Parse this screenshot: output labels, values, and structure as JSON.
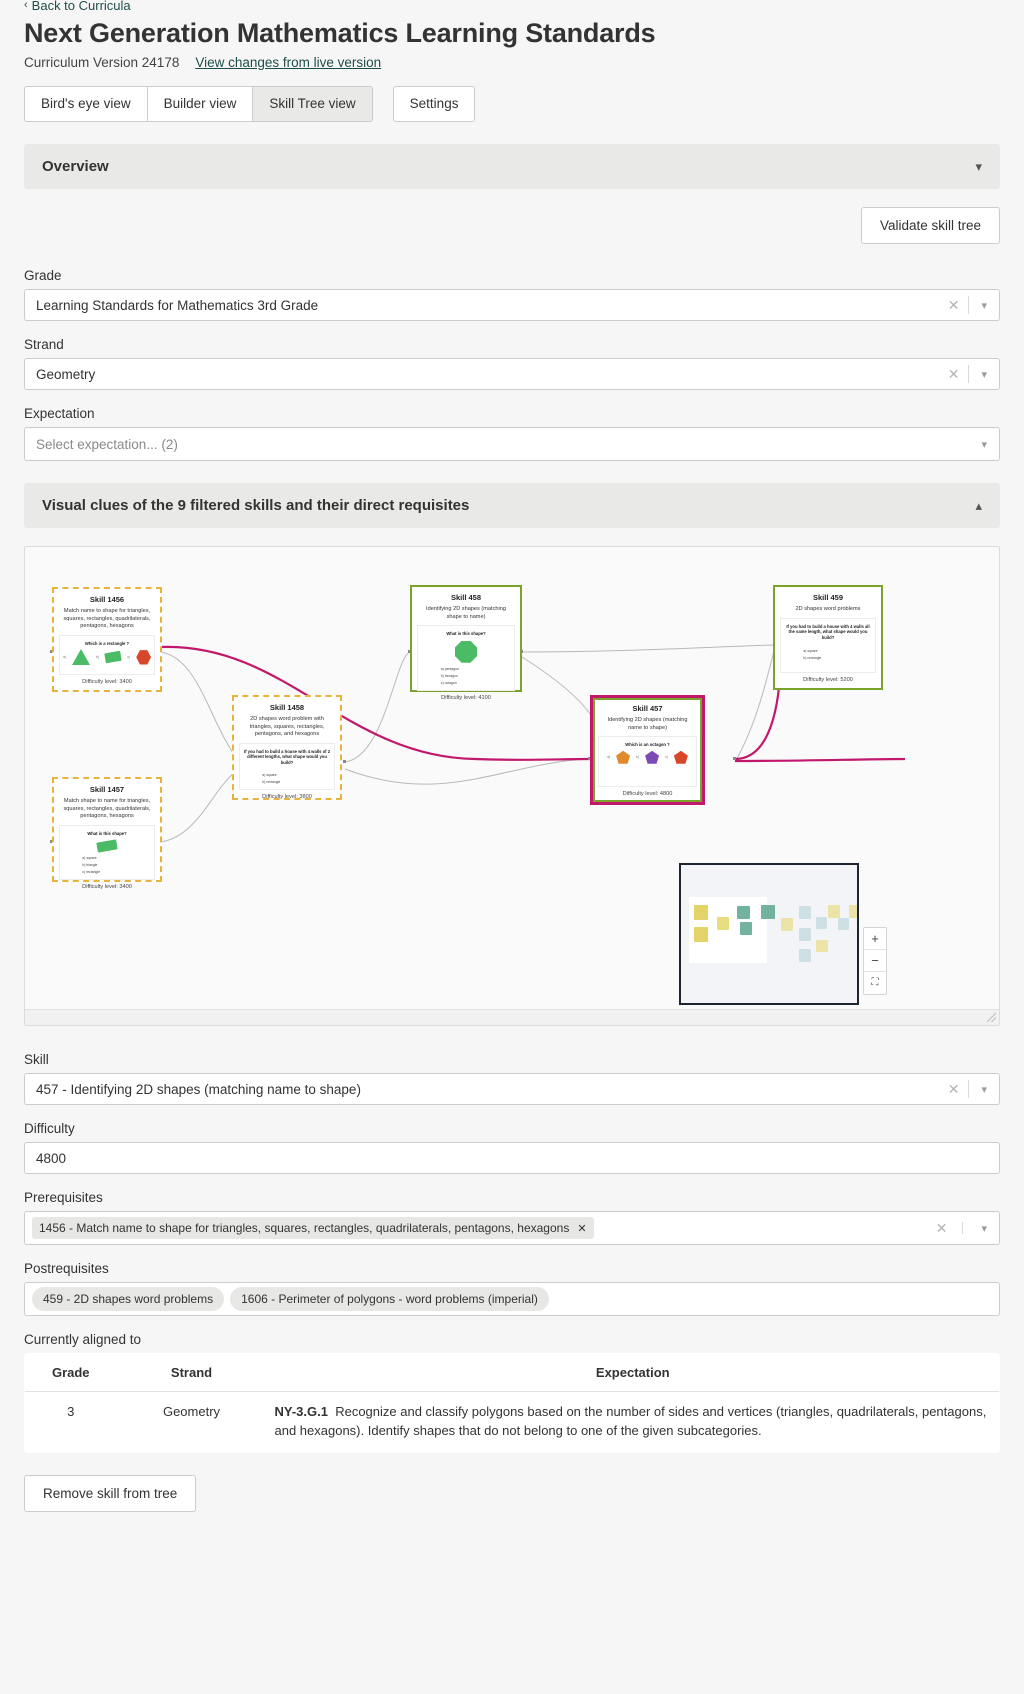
{
  "header": {
    "back_link": "Back to Curricula",
    "back_chevron": "chevron-left-icon",
    "title": "Next Generation Mathematics Learning Standards",
    "version": "Curriculum Version 24178",
    "changes_link": "View changes from live version"
  },
  "tabs": [
    {
      "label": "Bird's eye view",
      "active": false
    },
    {
      "label": "Builder view",
      "active": false
    },
    {
      "label": "Skill Tree view",
      "active": true
    },
    {
      "label": "Settings",
      "active": false,
      "standalone": true
    }
  ],
  "overview": {
    "title": "Overview",
    "chevron": "chevron-down-icon"
  },
  "actions": {
    "validate": "Validate skill tree",
    "remove_skill": "Remove skill from tree"
  },
  "filters": {
    "grade_label": "Grade",
    "grade_value": "Learning Standards for Mathematics 3rd Grade",
    "strand_label": "Strand",
    "strand_value": "Geometry",
    "expectation_label": "Expectation",
    "expectation_placeholder": "Select expectation... (2)"
  },
  "visual": {
    "title": "Visual clues of the 9 filtered skills and their direct requisites",
    "chevron": "chevron-up-icon",
    "zoom_in": "+",
    "zoom_out": "−",
    "fit_view": "fit-view-icon"
  },
  "graph": {
    "nodes": [
      {
        "id": "1456",
        "title": "Skill 1456",
        "desc": "Match name to shape for triangles, squares, rectangles, quadrilaterals, pentagons, hexagons",
        "question": "Which is a rectangle ?",
        "options": [
          "a)",
          "b)",
          "c)"
        ],
        "difficulty": "Difficulty level: 3400",
        "style": "dashed"
      },
      {
        "id": "1457",
        "title": "Skill 1457",
        "desc": "Match shape to name for triangles, squares, rectangles, quadrilaterals, pentagons, hexagons",
        "question": "What is this shape?",
        "options": [
          "a) square",
          "b) triangle",
          "c) rectangle"
        ],
        "difficulty": "Difficulty level: 3400",
        "style": "dashed"
      },
      {
        "id": "1458",
        "title": "Skill 1458",
        "desc": "2D shapes word problem with triangles, squares, rectangles, pentagons, and hexagons",
        "question": "If you had to build a house with 4 walls of 2 different lengths, what shape would you build?",
        "options": [
          "a) square",
          "b) rectangle"
        ],
        "difficulty": "Difficulty level: 3800",
        "style": "dashed"
      },
      {
        "id": "458",
        "title": "Skill 458",
        "desc": "Identifying 2D shapes (matching shape to name)",
        "question": "What is this shape?",
        "options": [
          "a) pentagon",
          "b) hexagon",
          "c) octagon"
        ],
        "difficulty": "Difficulty level: 4100",
        "style": "green"
      },
      {
        "id": "459",
        "title": "Skill 459",
        "desc": "2D shapes word problems",
        "question": "If you had to build a house with 4 walls all the same length, what shape would you build?",
        "options": [
          "a) square",
          "b) rectangle"
        ],
        "difficulty": "Difficulty level: 5200",
        "style": "green"
      },
      {
        "id": "457",
        "title": "Skill 457",
        "desc": "Identifying 2D shapes (matching name to shape)",
        "question": "Which is an octagon ?",
        "options": [
          "a)",
          "b)",
          "c)"
        ],
        "difficulty": "Difficulty level: 4800",
        "style": "sel"
      }
    ]
  },
  "detail": {
    "skill_label": "Skill",
    "skill_value": "457 - Identifying 2D shapes (matching name to shape)",
    "difficulty_label": "Difficulty",
    "difficulty_value": "4800",
    "prerequisites_label": "Prerequisites",
    "prerequisites": [
      "1456 - Match name to shape for triangles, squares, rectangles, quadrilaterals, pentagons, hexagons"
    ],
    "postrequisites_label": "Postrequisites",
    "postrequisites": [
      "459 - 2D shapes word problems",
      "1606 - Perimeter of polygons - word problems (imperial)"
    ],
    "aligned_label": "Currently aligned to"
  },
  "aligned_table": {
    "headers": [
      "Grade",
      "Strand",
      "Expectation"
    ],
    "rows": [
      {
        "grade": "3",
        "strand": "Geometry",
        "expectation_code": "NY-3.G.1",
        "expectation_text": "Recognize and classify polygons based on the number of sides and vertices (triangles, quadrilaterals, pentagons, and hexagons). Identify shapes that do not belong to one of the given subcategories."
      }
    ]
  },
  "colors": {
    "accent_link": "#1f4e4a",
    "node_dashed": "#e8b33c",
    "node_green": "#7aa32b",
    "node_selected": "#c2186c",
    "edge_highlight": "#c2186c",
    "edge_normal": "#b9b9b9"
  }
}
